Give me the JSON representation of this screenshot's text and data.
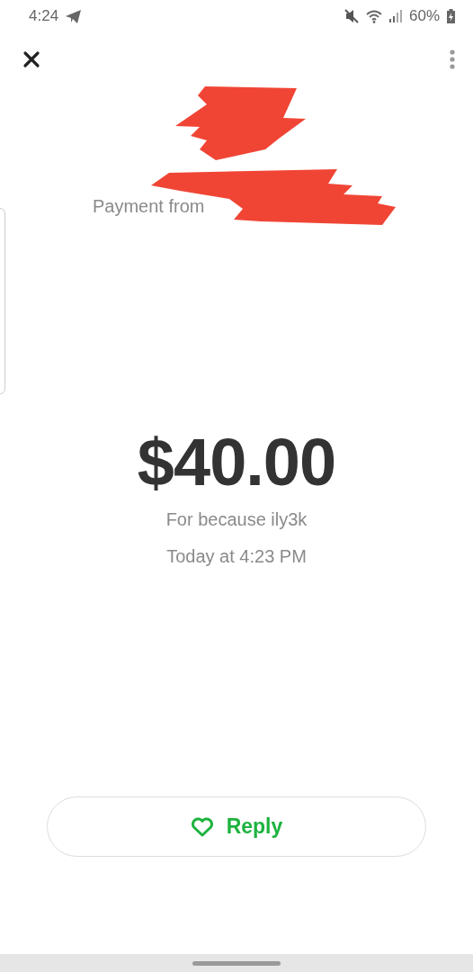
{
  "status_bar": {
    "time": "4:24",
    "battery": "60%"
  },
  "payment": {
    "subtitle": "Payment from",
    "amount": "$40.00",
    "note": "For because ily3k",
    "date": "Today at 4:23 PM"
  },
  "reply_button": {
    "label": "Reply"
  }
}
